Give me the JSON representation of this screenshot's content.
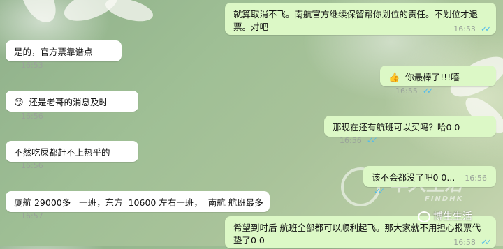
{
  "messages": [
    {
      "dir": "out",
      "text": "就算取消不飞。南航官方继续保留帮你划位的责任。不划位才退票。对吧",
      "time": "16:53",
      "ticks": "✓✓"
    },
    {
      "dir": "in",
      "text": "是的，官方票靠谱点",
      "time": "16:53"
    },
    {
      "dir": "out",
      "text": "你最棒了!!!嘻",
      "emoji": "👍",
      "time": "16:55",
      "ticks": "✓✓"
    },
    {
      "dir": "in",
      "text": "还是老哥的消息及时",
      "emoji": "😏",
      "time": "16:56"
    },
    {
      "dir": "out",
      "text": "那现在还有航班可以买吗？哈0 0",
      "time": "16:56",
      "ticks": "✓✓"
    },
    {
      "dir": "in",
      "text": "不然吃屎都赶不上热乎的",
      "time": "16:56"
    },
    {
      "dir": "out",
      "text": "该不会都没了吧0 0...",
      "time": "16:56",
      "ticks": "✓✓"
    },
    {
      "dir": "in",
      "text": "厦航 29000多   一班，东方  10600 左右一班，  南航 航班最多",
      "time": "16:57"
    },
    {
      "dir": "out",
      "text": "希望到时后 航班全部都可以顺利起飞。那大家就不用担心报票代垫了0 0",
      "time": "16:58",
      "ticks": "✓✓"
    }
  ],
  "watermark": {
    "text": "华人生活",
    "sub": "FINDHK"
  },
  "account": {
    "label": "博生生活"
  },
  "colors": {
    "incoming": "#ffffff",
    "outgoing": "#dcf8c6",
    "read_ticks": "#53bdeb"
  }
}
